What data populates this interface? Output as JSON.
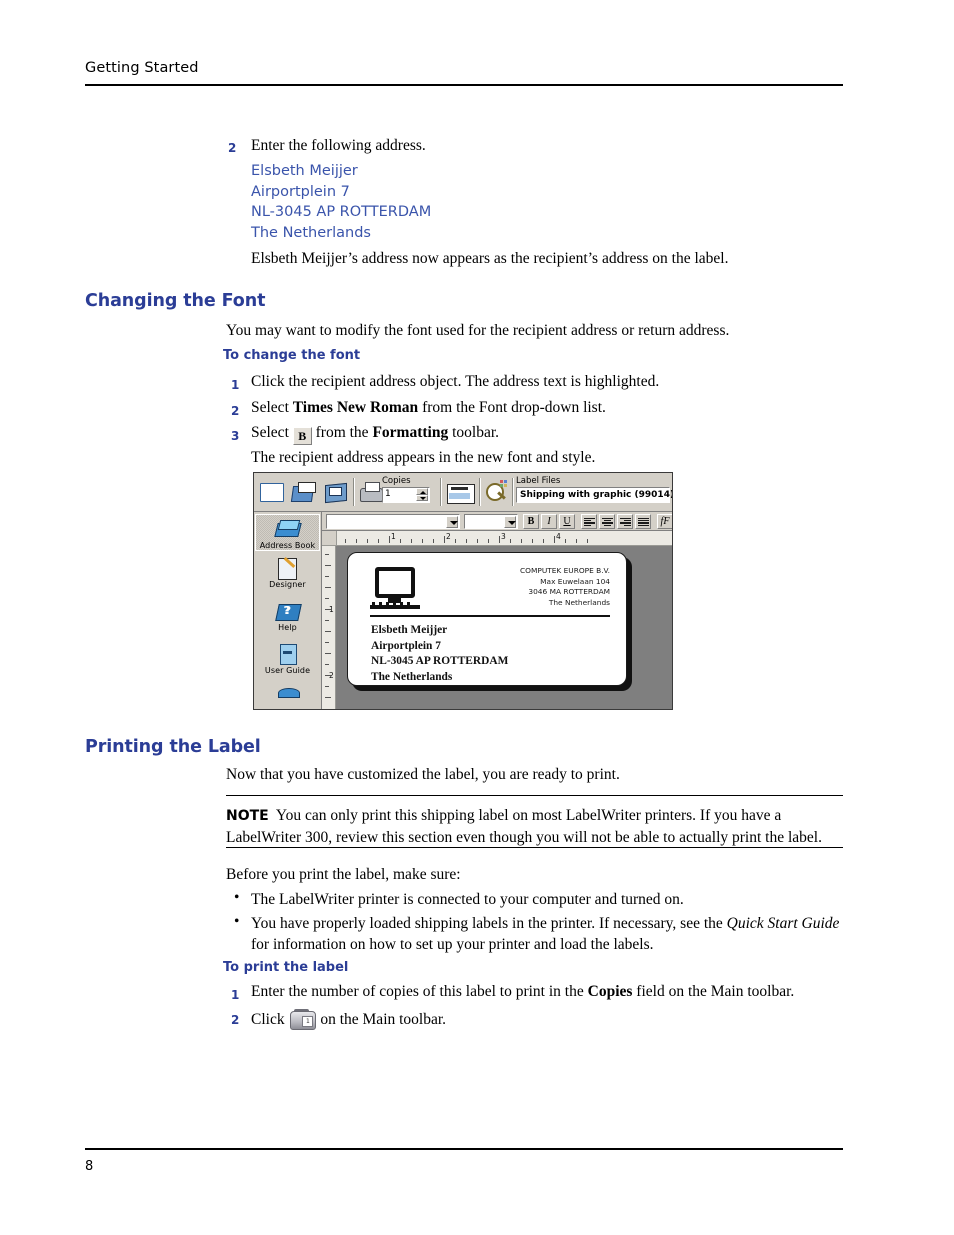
{
  "running_head": "Getting Started",
  "page_number": "8",
  "colors": {
    "heading_blue": "#2b3d96",
    "address_blue": "#3a54ab",
    "body_black": "#000000"
  },
  "step2_top": {
    "number": "2",
    "text": "Enter the following address.",
    "address_lines": [
      "Elsbeth Meijjer",
      "Airportplein 7",
      "NL-3045 AP ROTTERDAM",
      "The Netherlands"
    ],
    "result_text": "Elsbeth Meijjer’s address now appears as the recipient’s address on the label."
  },
  "changing_font": {
    "heading": "Changing the Font",
    "intro": "You may want to modify the font used for the recipient address or return address.",
    "subheading": "To change the font",
    "steps": [
      {
        "number": "1",
        "text": "Click the recipient address object. The address text is highlighted."
      },
      {
        "number": "2",
        "pre": "Select ",
        "bold": "Times New Roman",
        "post": " from the Font drop-down list."
      },
      {
        "number": "3",
        "pre": "Select ",
        "button_label": "B",
        "mid": " from the ",
        "bold": "Formatting",
        "post": " toolbar."
      }
    ],
    "result_text": "The recipient address appears in the new font and style."
  },
  "app_screenshot": {
    "main_toolbar": {
      "icons": [
        {
          "name": "new-label-icon",
          "title": "New"
        },
        {
          "name": "open-file-icon",
          "title": "Open"
        },
        {
          "name": "save-file-icon",
          "title": "Save"
        },
        {
          "name": "print-icon",
          "title": "Print"
        },
        {
          "name": "print-settings-icon",
          "title": "Print Settings"
        },
        {
          "name": "print-preview-icon",
          "title": "Print Preview"
        }
      ],
      "copies": {
        "label": "Copies",
        "value": "1"
      },
      "label_files": {
        "label": "Label Files",
        "value": "Shipping with graphic (99014)"
      }
    },
    "formatting_toolbar": {
      "font_value": "",
      "size_value": "",
      "buttons": [
        "B",
        "I",
        "U"
      ],
      "align_buttons": [
        "align-left",
        "align-center",
        "align-right",
        "align-justify"
      ],
      "effects_button": "fF"
    },
    "sidebar": [
      {
        "label": "Address Book",
        "icon": "address-book-icon",
        "selected": true
      },
      {
        "label": "Designer",
        "icon": "designer-icon",
        "selected": false
      },
      {
        "label": "Help",
        "icon": "help-icon",
        "selected": false
      },
      {
        "label": "User Guide",
        "icon": "user-guide-icon",
        "selected": false
      }
    ],
    "ruler": {
      "numbers": [
        "1",
        "2",
        "3",
        "4"
      ]
    },
    "vruler": {
      "numbers": [
        "1",
        "2"
      ]
    },
    "label": {
      "return_address": [
        "COMPUTEK EUROPE B.V.",
        "Max Euwelaan 104",
        "3046 MA  ROTTERDAM",
        "The Netherlands"
      ],
      "recipient_address": "Elsbeth Meijjer\nAirportplein 7\nNL-3045 AP ROTTERDAM\nThe Netherlands"
    }
  },
  "printing_label": {
    "heading": "Printing the Label",
    "intro": "Now that you have customized the label, you are ready to print.",
    "note_label": "NOTE",
    "note_text": "You can only print this shipping label on most LabelWriter printers. If you have a LabelWriter 300, review this section even though you will not be able to actually print the label.",
    "before_text": "Before you print the label, make sure:",
    "bullets": [
      {
        "text": "The LabelWriter printer is connected to your computer and turned on."
      },
      {
        "pre": "You have properly loaded shipping labels in the printer. If necessary, see the ",
        "italic": "Quick Start Guide",
        "post": " for information on how to set up your printer and load the labels."
      }
    ],
    "subheading": "To print the label",
    "steps": [
      {
        "number": "1",
        "pre": "Enter the number of copies of this label to print in the ",
        "bold": "Copies",
        "post": " field on the Main toolbar."
      },
      {
        "number": "2",
        "pre": "Click ",
        "icon": "printer-icon",
        "post": " on the Main toolbar."
      }
    ]
  }
}
